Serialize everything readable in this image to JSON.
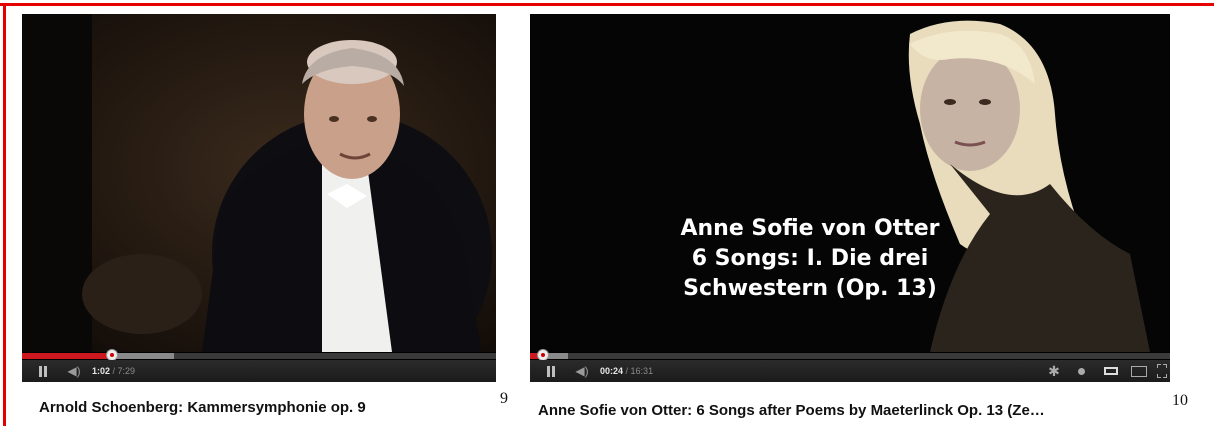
{
  "videos": [
    {
      "caption": "Arnold Schoenberg: Kammersymphonie op. 9",
      "number": "9",
      "current_time": "1:02",
      "duration": "/ 7:29",
      "played_fraction": 0.19,
      "buffered_fraction": 0.32,
      "icons": [
        "pause-icon",
        "volume-icon"
      ]
    },
    {
      "caption": "Anne Sofie von Otter: 6 Songs after Poems by Maeterlinck Op. 13 (Ze…",
      "number": "10",
      "current_time": "00:24",
      "duration": "/ 16:31",
      "played_fraction": 0.02,
      "buffered_fraction": 0.06,
      "overlay_lines": [
        "Anne Sofie von Otter",
        "6 Songs: I. Die drei",
        "Schwestern (Op. 13)"
      ],
      "icons": [
        "pause-icon",
        "volume-icon",
        "settings-gear-icon",
        "annotations-icon",
        "small-player-icon",
        "large-player-icon",
        "fullscreen-icon"
      ]
    }
  ],
  "colors": {
    "frame": "#e60000",
    "played": "#cc181e"
  }
}
